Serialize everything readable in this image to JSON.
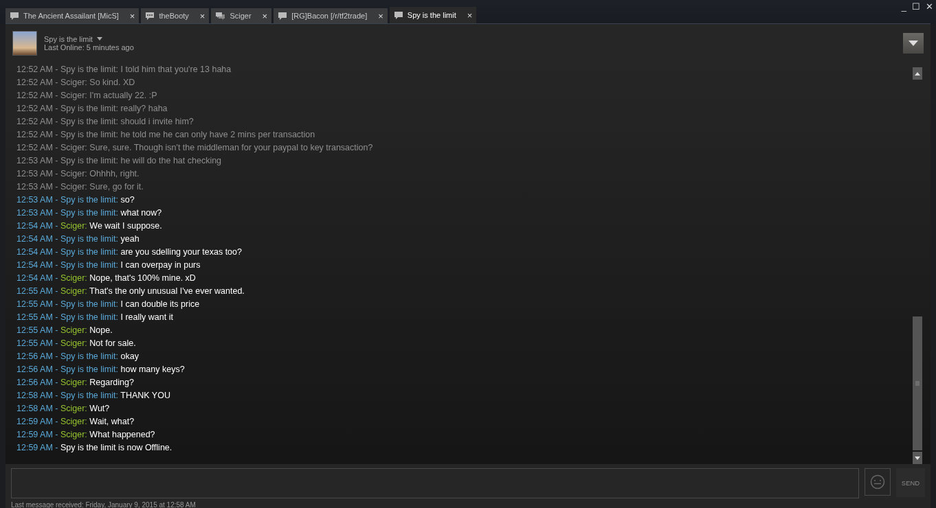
{
  "tabs": [
    {
      "label": "The Ancient Assailant [MicS]",
      "kind": "single",
      "selected": false
    },
    {
      "label": "theBooty",
      "kind": "typing",
      "selected": false
    },
    {
      "label": "Sciger",
      "kind": "double",
      "selected": false
    },
    {
      "label": "[RG]Bacon [/r/tf2trade]",
      "kind": "single",
      "selected": false
    },
    {
      "label": "Spy is the limit",
      "kind": "single",
      "selected": true
    }
  ],
  "close_glyph": "×",
  "window_controls": {
    "minimize": "_",
    "maximize": "☐",
    "close": "✕"
  },
  "friend": {
    "name": "Spy is the limit",
    "status": "Last Online: 5 minutes ago"
  },
  "messages": [
    {
      "kind": "history",
      "line": "12:52 AM - Spy is the limit: I told him that you're 13 haha"
    },
    {
      "kind": "history",
      "line": "12:52 AM - Sciger: So kind. XD"
    },
    {
      "kind": "history",
      "line": "12:52 AM - Sciger: I'm actually 22. :P"
    },
    {
      "kind": "history",
      "line": "12:52 AM - Spy is the limit: really? haha"
    },
    {
      "kind": "history",
      "line": "12:52 AM - Spy is the limit: should i invite him?"
    },
    {
      "kind": "history",
      "line": "12:52 AM - Spy is the limit: he told me he can only have 2 mins per transaction"
    },
    {
      "kind": "history",
      "line": "12:52 AM - Sciger: Sure, sure. Though isn't the middleman for your paypal to key transaction?"
    },
    {
      "kind": "history",
      "line": "12:53 AM - Spy is the limit: he will do the hat checking"
    },
    {
      "kind": "history",
      "line": "12:53 AM - Sciger: Ohhhh, right."
    },
    {
      "kind": "history",
      "line": "12:53 AM - Sciger: Sure, go for it."
    },
    {
      "kind": "message",
      "time": "12:53 AM -",
      "sender": "Spy is the limit:",
      "color": "#5aa9d8",
      "text": "so?"
    },
    {
      "kind": "message",
      "time": "12:53 AM -",
      "sender": "Spy is the limit:",
      "color": "#5aa9d8",
      "text": "what now?"
    },
    {
      "kind": "message",
      "time": "12:54 AM -",
      "sender": "Sciger:",
      "color": "#95c32e",
      "text": "We wait I suppose."
    },
    {
      "kind": "message",
      "time": "12:54 AM -",
      "sender": "Spy is the limit:",
      "color": "#5aa9d8",
      "text": "yeah"
    },
    {
      "kind": "message",
      "time": "12:54 AM -",
      "sender": "Spy is the limit:",
      "color": "#5aa9d8",
      "text": "are you sdelling your texas too?"
    },
    {
      "kind": "message",
      "time": "12:54 AM -",
      "sender": "Spy is the limit:",
      "color": "#5aa9d8",
      "text": "I can overpay in purs"
    },
    {
      "kind": "message",
      "time": "12:54 AM -",
      "sender": "Sciger:",
      "color": "#95c32e",
      "text": "Nope, that's 100% mine. xD"
    },
    {
      "kind": "message",
      "time": "12:55 AM -",
      "sender": "Sciger:",
      "color": "#95c32e",
      "text": "That's the only unusual I've ever wanted."
    },
    {
      "kind": "message",
      "time": "12:55 AM -",
      "sender": "Spy is the limit:",
      "color": "#5aa9d8",
      "text": "I can double its price"
    },
    {
      "kind": "message",
      "time": "12:55 AM -",
      "sender": "Spy is the limit:",
      "color": "#5aa9d8",
      "text": "I really want it"
    },
    {
      "kind": "message",
      "time": "12:55 AM -",
      "sender": "Sciger:",
      "color": "#95c32e",
      "text": "Nope."
    },
    {
      "kind": "message",
      "time": "12:55 AM -",
      "sender": "Sciger:",
      "color": "#95c32e",
      "text": "Not for sale."
    },
    {
      "kind": "message",
      "time": "12:56 AM -",
      "sender": "Spy is the limit:",
      "color": "#5aa9d8",
      "text": "okay"
    },
    {
      "kind": "message",
      "time": "12:56 AM -",
      "sender": "Spy is the limit:",
      "color": "#5aa9d8",
      "text": "how many keys?"
    },
    {
      "kind": "message",
      "time": "12:56 AM -",
      "sender": "Sciger:",
      "color": "#95c32e",
      "text": "Regarding?"
    },
    {
      "kind": "message",
      "time": "12:58 AM -",
      "sender": "Spy is the limit:",
      "color": "#5aa9d8",
      "text": "THANK YOU"
    },
    {
      "kind": "message",
      "time": "12:58 AM -",
      "sender": "Sciger:",
      "color": "#95c32e",
      "text": "Wut?"
    },
    {
      "kind": "message",
      "time": "12:59 AM -",
      "sender": "Sciger:",
      "color": "#95c32e",
      "text": "Wait, what?"
    },
    {
      "kind": "message",
      "time": "12:59 AM -",
      "sender": "Sciger:",
      "color": "#95c32e",
      "text": "What happened?"
    },
    {
      "kind": "status",
      "time": "12:59 AM -",
      "text": "Spy is the limit is now Offline."
    }
  ],
  "send_button": "SEND",
  "status_bar": "Last message received: Friday, January 9, 2015 at 12:58 AM"
}
